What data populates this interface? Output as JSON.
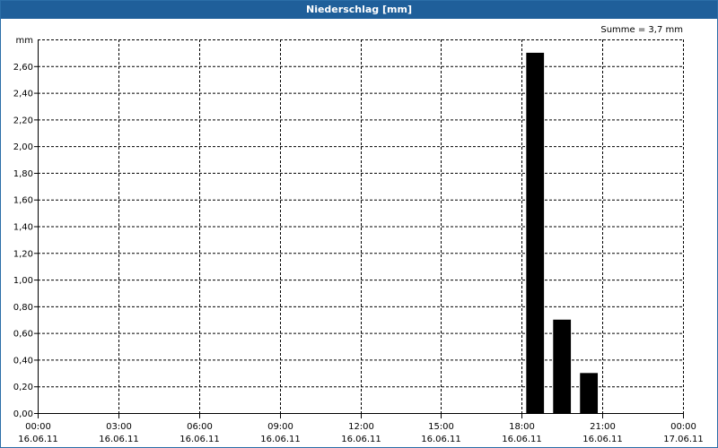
{
  "window": {
    "title": "Niederschlag [mm]"
  },
  "chart_data": {
    "type": "bar",
    "title": "Niederschlag [mm]",
    "ylabel": "mm",
    "summary": "Summe = 3,7 mm",
    "ylim": [
      0,
      2.8
    ],
    "y_ticks": [
      "0,00",
      "0,20",
      "0,40",
      "0,60",
      "0,80",
      "1,00",
      "1,20",
      "1,40",
      "1,60",
      "1,80",
      "2,00",
      "2,20",
      "2,40",
      "2,60"
    ],
    "y_tick_values": [
      0,
      0.2,
      0.4,
      0.6,
      0.8,
      1.0,
      1.2,
      1.4,
      1.6,
      1.8,
      2.0,
      2.2,
      2.4,
      2.6
    ],
    "x_ticks": [
      {
        "time": "00:00",
        "date": "16.06.11"
      },
      {
        "time": "03:00",
        "date": "16.06.11"
      },
      {
        "time": "06:00",
        "date": "16.06.11"
      },
      {
        "time": "09:00",
        "date": "16.06.11"
      },
      {
        "time": "12:00",
        "date": "16.06.11"
      },
      {
        "time": "15:00",
        "date": "16.06.11"
      },
      {
        "time": "18:00",
        "date": "16.06.11"
      },
      {
        "time": "21:00",
        "date": "16.06.11"
      },
      {
        "time": "00:00",
        "date": "17.06.11"
      }
    ],
    "xlim_hours": [
      0,
      24
    ],
    "grid": true,
    "bars": [
      {
        "start": "18:00",
        "end": "19:00",
        "value": 2.7
      },
      {
        "start": "19:00",
        "end": "20:00",
        "value": 0.7
      },
      {
        "start": "20:00",
        "end": "21:00",
        "value": 0.3
      }
    ],
    "bar_color": "#000000",
    "grid_color": "#000000"
  }
}
